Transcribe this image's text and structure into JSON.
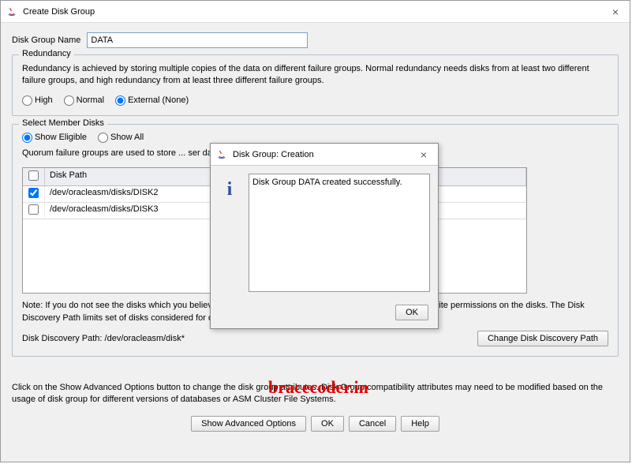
{
  "window": {
    "title": "Create Disk Group"
  },
  "form": {
    "name_label": "Disk Group Name",
    "name_value": "DATA"
  },
  "redundancy": {
    "title": "Redundancy",
    "desc": "Redundancy is achieved by storing multiple copies of the data on different failure groups. Normal redundancy needs disks from at least two different failure groups, and high redundancy from at least three different failure groups.",
    "options": {
      "high": "High",
      "normal": "Normal",
      "external": "External (None)"
    },
    "selected": "external"
  },
  "member": {
    "title": "Select Member Disks",
    "eligible": "Show Eligible",
    "all": "Show All",
    "selected": "eligible",
    "quorum_note": "Quorum failure groups are used to store ... ser data. They require ASM compatibility of 11.2 or higher.",
    "columns": {
      "path": "Disk Path"
    },
    "rows": [
      {
        "checked": true,
        "path": "/dev/oracleasm/disks/DISK2"
      },
      {
        "checked": false,
        "path": "/dev/oracleasm/disks/DISK3"
      }
    ],
    "note": "Note: If you do not see the disks which you believe are available, check the Disk Discovery Path and read/write permissions on the disks. The Disk Discovery Path limits set of disks considered for discovery.",
    "discovery_label": "Disk Discovery Path: /dev/oracleasm/disk*",
    "change_btn": "Change Disk Discovery Path"
  },
  "footer": {
    "text": "Click on the Show Advanced Options button to change the disk group attributes. Disk Group compatibility attributes may need to be modified based on the usage of disk group for different versions of databases or ASM Cluster File Systems.",
    "advanced": "Show Advanced Options",
    "ok": "OK",
    "cancel": "Cancel",
    "help": "Help"
  },
  "modal": {
    "title": "Disk Group: Creation",
    "message": "Disk Group DATA created successfully.",
    "ok": "OK"
  },
  "watermark": "bracecoder.in"
}
